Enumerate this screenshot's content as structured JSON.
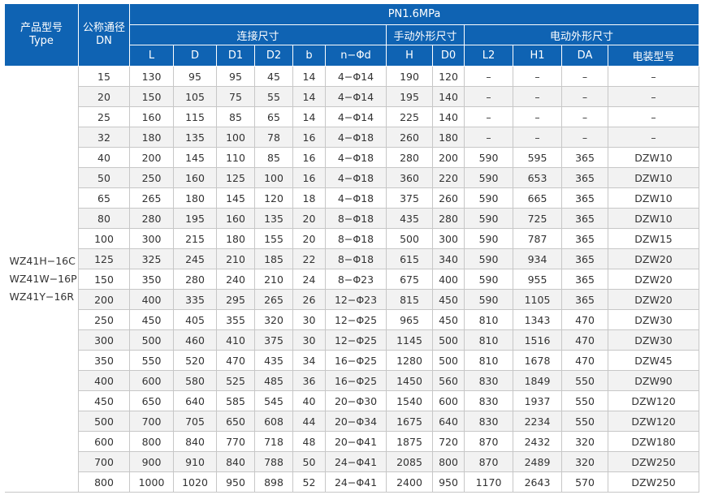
{
  "header": {
    "product_model": "产品型号",
    "type": "Type",
    "nominal_size": "公称通径",
    "dn": "DN",
    "pressure": "PN1.6MPa",
    "connection_dims": "连接尺寸",
    "manual_dims": "手动外形尺寸",
    "electric_dims": "电动外形尺寸",
    "columns": [
      "L",
      "D",
      "D1",
      "D2",
      "b",
      "n−Φd",
      "H",
      "D0",
      "L2",
      "H1",
      "DA",
      "电装型号"
    ]
  },
  "models": [
    "WZ41H−16C",
    "WZ41W−16P",
    "WZ41Y−16R"
  ],
  "rows": [
    [
      "15",
      "130",
      "95",
      "95",
      "45",
      "14",
      "4−Φ14",
      "190",
      "120",
      "–",
      "–",
      "–",
      "–"
    ],
    [
      "20",
      "150",
      "105",
      "75",
      "55",
      "14",
      "4−Φ14",
      "195",
      "140",
      "–",
      "–",
      "–",
      "–"
    ],
    [
      "25",
      "160",
      "115",
      "85",
      "65",
      "14",
      "4−Φ14",
      "225",
      "140",
      "–",
      "–",
      "–",
      "–"
    ],
    [
      "32",
      "180",
      "135",
      "100",
      "78",
      "16",
      "4−Φ18",
      "260",
      "180",
      "–",
      "–",
      "–",
      "–"
    ],
    [
      "40",
      "200",
      "145",
      "110",
      "85",
      "16",
      "4−Φ18",
      "280",
      "200",
      "590",
      "595",
      "365",
      "DZW10"
    ],
    [
      "50",
      "250",
      "160",
      "125",
      "100",
      "16",
      "4−Φ18",
      "360",
      "220",
      "590",
      "653",
      "365",
      "DZW10"
    ],
    [
      "65",
      "265",
      "180",
      "145",
      "120",
      "18",
      "4−Φ18",
      "375",
      "260",
      "590",
      "665",
      "365",
      "DZW10"
    ],
    [
      "80",
      "280",
      "195",
      "160",
      "135",
      "20",
      "8−Φ18",
      "435",
      "280",
      "590",
      "725",
      "365",
      "DZW10"
    ],
    [
      "100",
      "300",
      "215",
      "180",
      "155",
      "20",
      "8−Φ18",
      "500",
      "300",
      "590",
      "787",
      "365",
      "DZW15"
    ],
    [
      "125",
      "325",
      "245",
      "210",
      "185",
      "22",
      "8−Φ18",
      "615",
      "340",
      "590",
      "934",
      "365",
      "DZW20"
    ],
    [
      "150",
      "350",
      "280",
      "240",
      "210",
      "24",
      "8−Φ23",
      "675",
      "400",
      "590",
      "955",
      "365",
      "DZW20"
    ],
    [
      "200",
      "400",
      "335",
      "295",
      "265",
      "26",
      "12−Φ23",
      "815",
      "450",
      "590",
      "1105",
      "365",
      "DZW20"
    ],
    [
      "250",
      "450",
      "405",
      "355",
      "320",
      "30",
      "12−Φ25",
      "965",
      "450",
      "810",
      "1343",
      "470",
      "DZW30"
    ],
    [
      "300",
      "500",
      "460",
      "410",
      "375",
      "30",
      "12−Φ25",
      "1145",
      "500",
      "810",
      "1516",
      "470",
      "DZW30"
    ],
    [
      "350",
      "550",
      "520",
      "470",
      "435",
      "34",
      "16−Φ25",
      "1280",
      "500",
      "810",
      "1678",
      "470",
      "DZW45"
    ],
    [
      "400",
      "600",
      "580",
      "525",
      "485",
      "36",
      "16−Φ25",
      "1450",
      "560",
      "830",
      "1849",
      "550",
      "DZW90"
    ],
    [
      "450",
      "650",
      "640",
      "585",
      "545",
      "40",
      "20−Φ30",
      "1540",
      "600",
      "830",
      "1937",
      "550",
      "DZW120"
    ],
    [
      "500",
      "700",
      "705",
      "650",
      "608",
      "44",
      "20−Φ34",
      "1675",
      "640",
      "830",
      "2234",
      "550",
      "DZW120"
    ],
    [
      "600",
      "800",
      "840",
      "770",
      "718",
      "48",
      "20−Φ41",
      "1875",
      "720",
      "870",
      "2432",
      "320",
      "DZW180"
    ],
    [
      "700",
      "900",
      "910",
      "840",
      "788",
      "50",
      "24−Φ41",
      "2085",
      "800",
      "870",
      "2489",
      "320",
      "DZW250"
    ],
    [
      "800",
      "1000",
      "1020",
      "950",
      "898",
      "52",
      "24−Φ41",
      "2400",
      "950",
      "1170",
      "2643",
      "570",
      "DZW250"
    ]
  ]
}
